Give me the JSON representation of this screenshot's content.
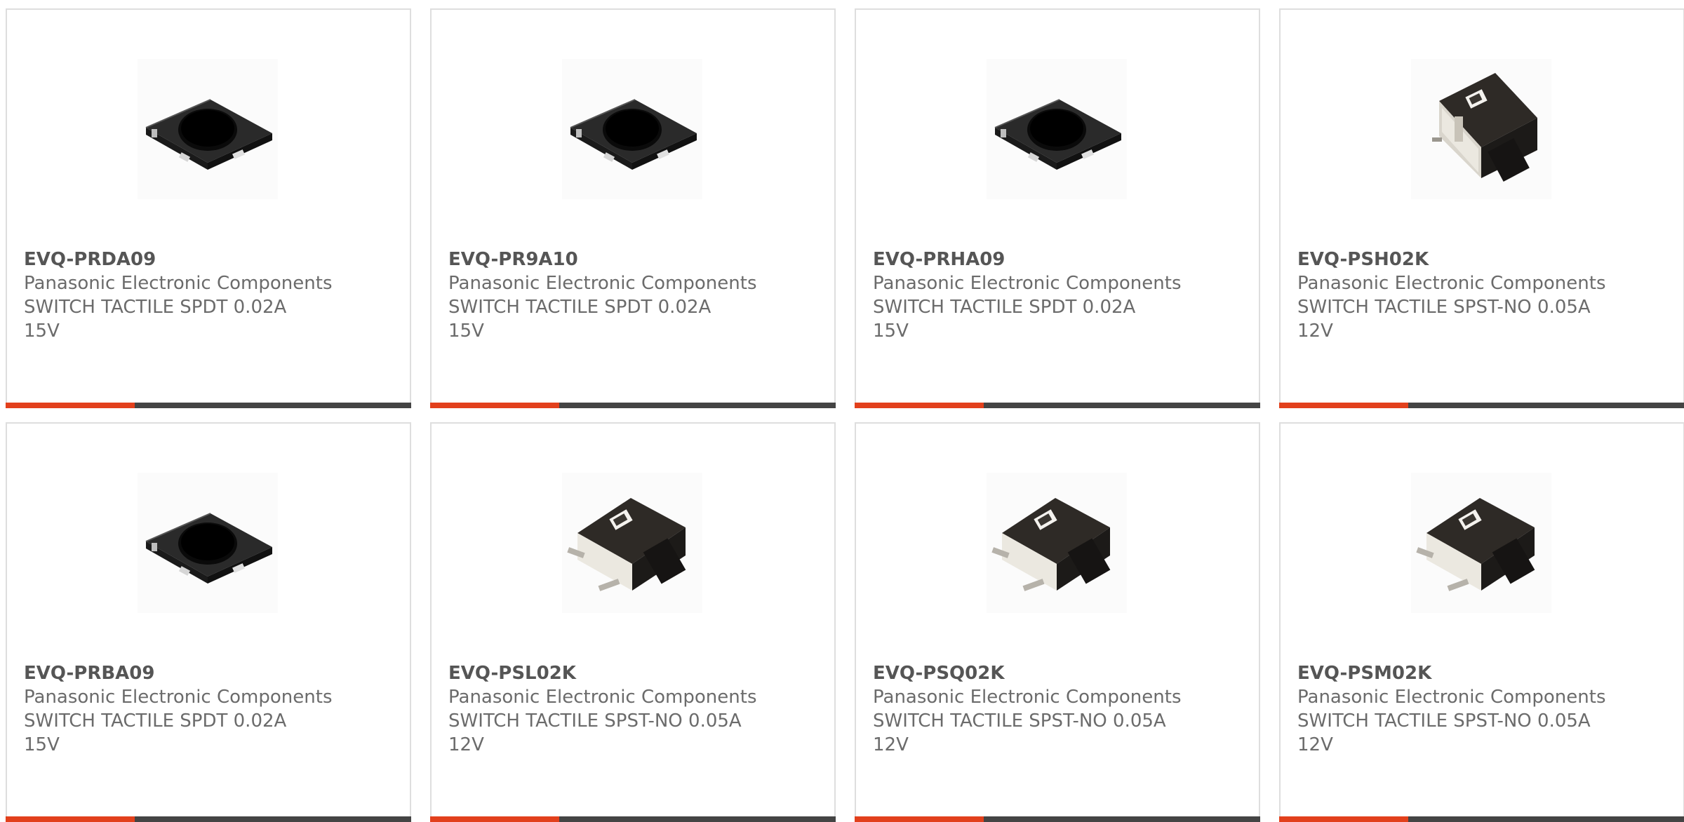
{
  "accent_color": "#e2401c",
  "bar_color": "#444444",
  "products": [
    {
      "part_number": "EVQ-PRDA09",
      "manufacturer": "Panasonic Electronic Components",
      "desc_line1": "SWITCH TACTILE SPDT 0.02A",
      "desc_line2": "15V",
      "image": "square-tactile-switch-image"
    },
    {
      "part_number": "EVQ-PR9A10",
      "manufacturer": "Panasonic Electronic Components",
      "desc_line1": "SWITCH TACTILE SPDT 0.02A",
      "desc_line2": "15V",
      "image": "square-tactile-switch-image"
    },
    {
      "part_number": "EVQ-PRHA09",
      "manufacturer": "Panasonic Electronic Components",
      "desc_line1": "SWITCH TACTILE SPDT 0.02A",
      "desc_line2": "15V",
      "image": "square-tactile-switch-image"
    },
    {
      "part_number": "EVQ-PSH02K",
      "manufacturer": "Panasonic Electronic Components",
      "desc_line1": "SWITCH TACTILE SPST-NO 0.05A",
      "desc_line2": "12V",
      "image": "side-actuated-switch-image"
    },
    {
      "part_number": "EVQ-PRBA09",
      "manufacturer": "Panasonic Electronic Components",
      "desc_line1": "SWITCH TACTILE SPDT 0.02A",
      "desc_line2": "15V",
      "image": "square-tactile-switch-image"
    },
    {
      "part_number": "EVQ-PSL02K",
      "manufacturer": "Panasonic Electronic Components",
      "desc_line1": "SWITCH TACTILE SPST-NO 0.05A",
      "desc_line2": "12V",
      "image": "side-actuated-switch-image"
    },
    {
      "part_number": "EVQ-PSQ02K",
      "manufacturer": "Panasonic Electronic Components",
      "desc_line1": "SWITCH TACTILE SPST-NO 0.05A",
      "desc_line2": "12V",
      "image": "side-actuated-switch-image"
    },
    {
      "part_number": "EVQ-PSM02K",
      "manufacturer": "Panasonic Electronic Components",
      "desc_line1": "SWITCH TACTILE SPST-NO 0.05A",
      "desc_line2": "12V",
      "image": "side-actuated-switch-image"
    }
  ]
}
